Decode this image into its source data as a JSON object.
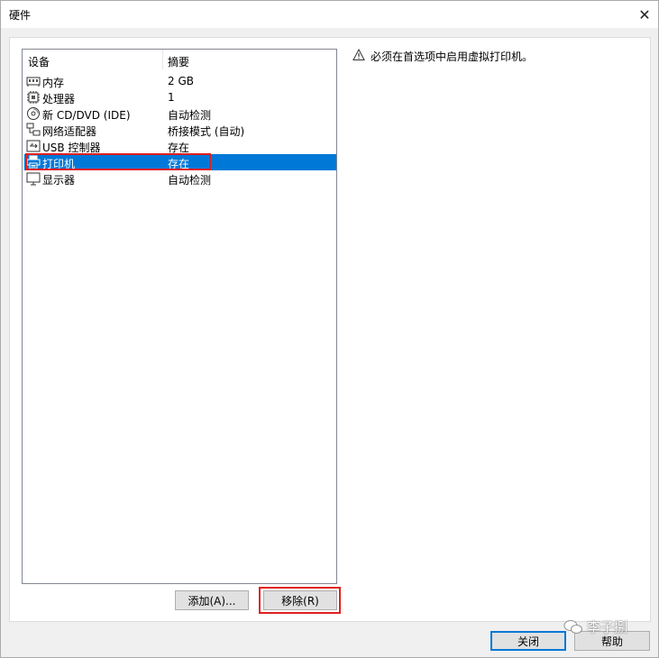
{
  "window": {
    "title": "硬件"
  },
  "list": {
    "col_device": "设备",
    "col_summary": "摘要",
    "rows": [
      {
        "icon": "memory-icon",
        "name": "内存",
        "summary": "2 GB"
      },
      {
        "icon": "processor-icon",
        "name": "处理器",
        "summary": "1"
      },
      {
        "icon": "cd-dvd-icon",
        "name": "新 CD/DVD (IDE)",
        "summary": "自动检测"
      },
      {
        "icon": "network-adapter-icon",
        "name": "网络适配器",
        "summary": "桥接模式 (自动)"
      },
      {
        "icon": "usb-controller-icon",
        "name": "USB 控制器",
        "summary": "存在"
      },
      {
        "icon": "printer-icon",
        "name": "打印机",
        "summary": "存在",
        "selected": true
      },
      {
        "icon": "display-icon",
        "name": "显示器",
        "summary": "自动检测"
      }
    ]
  },
  "info": {
    "message": "必须在首选项中启用虚拟打印机。"
  },
  "buttons": {
    "add": "添加(A)...",
    "remove": "移除(R)",
    "close": "关闭",
    "help": "帮助"
  },
  "watermark": {
    "text": "李子捌"
  },
  "colors": {
    "selection": "#0078d7",
    "annotation": "#e02020"
  }
}
